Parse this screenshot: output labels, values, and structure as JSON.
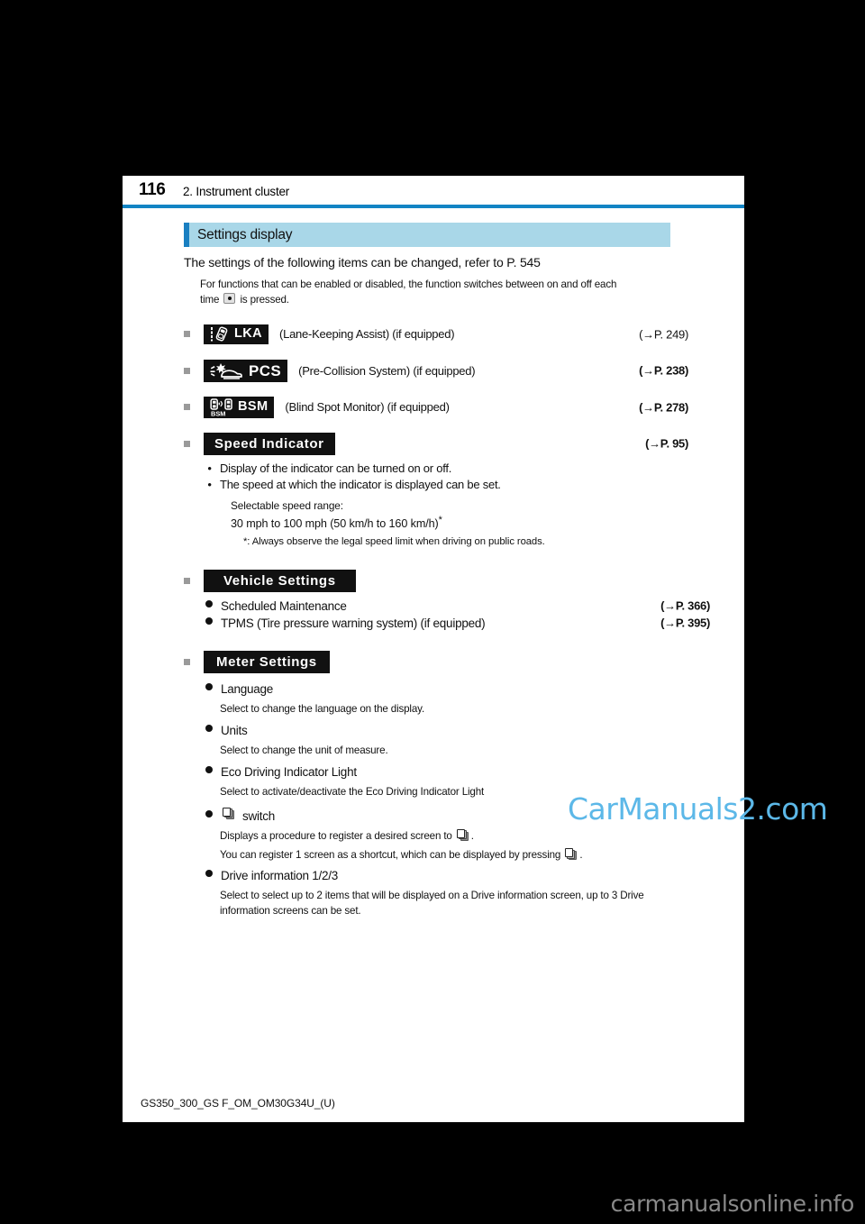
{
  "header": {
    "page_number": "116",
    "chapter_title": "2. Instrument cluster"
  },
  "section": {
    "title": "Settings display"
  },
  "intro": {
    "lead": "The settings of the following items can be changed, refer to P. 545",
    "note_before": "For functions that can be enabled or disabled, the function switches between on and off each time",
    "note_after": "is pressed."
  },
  "function_items": [
    {
      "icon": "lka-display-icon",
      "badge_text": "LKA",
      "label": "(Lane-Keeping Assist) (if equipped)",
      "pageref": "(→P. 249)"
    },
    {
      "icon": "pcs-display-icon",
      "badge_text": "PCS",
      "label": "(Pre-Collision System) (if equipped)",
      "pageref": "(→P. 238)"
    },
    {
      "icon": "bsm-display-icon",
      "badge_text": "BSM",
      "label": "(Blind Spot Monitor) (if equipped)",
      "pageref": "(→P. 278)"
    }
  ],
  "speed_indicator": {
    "badge_text": "Speed Indicator",
    "pageref": "(→P. 95)",
    "bullets": [
      "Display of the indicator can be turned on or off.",
      "The speed at which the indicator is displayed can be set."
    ],
    "range_label": "Selectable speed range:",
    "range_value": "30 mph to 100 mph (50 km/h to 160 km/h)",
    "range_star": "*",
    "footnote": "*: Always observe the legal speed limit when driving on public roads."
  },
  "vehicle_settings": {
    "badge_text": "Vehicle Settings",
    "items": [
      {
        "label": "Scheduled Maintenance",
        "pageref": "(→P. 366)"
      },
      {
        "label": "TPMS (Tire pressure warning system) (if equipped)",
        "pageref": "(→P. 395)"
      }
    ]
  },
  "meter_settings": {
    "badge_text": "Meter  Settings",
    "items": [
      {
        "label": "Language",
        "desc": "Select to change the language on the display."
      },
      {
        "label": "Units",
        "desc": "Select to change the unit of measure."
      },
      {
        "label": "Eco Driving Indicator Light",
        "desc": "Select to activate/deactivate the Eco Driving Indicator Light"
      },
      {
        "label": "switch",
        "desc_1_before": "Displays a procedure to register a desired screen to",
        "desc_1_after": ".",
        "desc_2_before": "You can register 1 screen as a shortcut, which can be displayed by pressing",
        "desc_2_after": "."
      },
      {
        "label": "Drive information 1/2/3",
        "desc": "Select to select up to 2 items that will be displayed on a Drive information screen, up to 3 Drive information screens can be set."
      }
    ]
  },
  "footer": {
    "document_code": "GS350_300_GS F_OM_OM30G34U_(U)"
  },
  "watermarks": {
    "inner": "CarManuals2.com",
    "bottom": "carmanualsonline.info"
  },
  "colors": {
    "rule_blue": "#1284c4",
    "band_blue": "#a9d7e8",
    "accent_blue": "#1a7fc1",
    "badge_black": "#111111",
    "watermark_blue": "#5cb8e8"
  }
}
